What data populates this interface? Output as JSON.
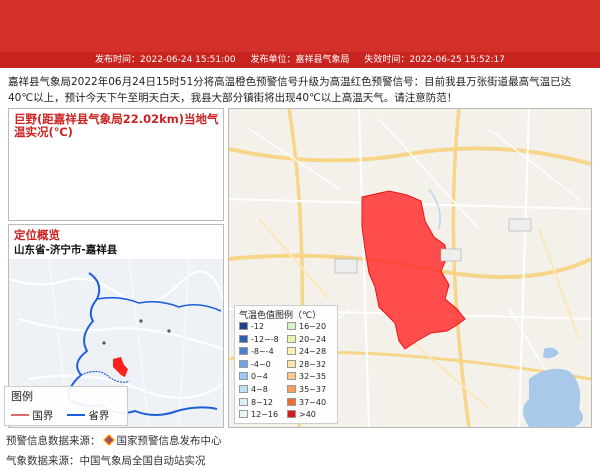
{
  "header": {
    "publish_time": "发布时间：2022-06-24 15:51:00",
    "publisher": "发布单位：嘉祥县气象局",
    "expire_time": "失效时间：2022-06-25 15:52:17"
  },
  "bulletin": "嘉祥县气象局2022年06月24日15时51分将高温橙色预警信号升级为高温红色预警信号：目前我县万张街道最高气温已达40℃以上，预计今天下午至明天白天，我县大部分镇街将出现40℃以上高温天气。请注意防范！",
  "station_panel": {
    "title": "巨野(距嘉祥县气象局22.02km)当地气温实况(℃)"
  },
  "location_panel": {
    "title": "定位概览",
    "subtitle": "山东省-济宁市-嘉祥县"
  },
  "mini_legend": {
    "title": "图例",
    "national_border": "国界",
    "provincial_border": "省界"
  },
  "color_legend": {
    "title": "气温色值图例（℃）",
    "items": [
      {
        "label": "-12",
        "color": "#1f3f8f"
      },
      {
        "label": "-12~-8",
        "color": "#2e5fb0"
      },
      {
        "label": "-8~-4",
        "color": "#4a7fd0"
      },
      {
        "label": "-4~0",
        "color": "#6fa3e8"
      },
      {
        "label": "0~4",
        "color": "#9cc8f2"
      },
      {
        "label": "4~8",
        "color": "#bfe1f7"
      },
      {
        "label": "8~12",
        "color": "#d9f0f7"
      },
      {
        "label": "12~16",
        "color": "#eaf7ee"
      },
      {
        "label": "16~20",
        "color": "#d7f2c7"
      },
      {
        "label": "20~24",
        "color": "#e8f5b0"
      },
      {
        "label": "24~28",
        "color": "#fbf2b4"
      },
      {
        "label": "28~32",
        "color": "#fde6a8"
      },
      {
        "label": "32~35",
        "color": "#fbc98a"
      },
      {
        "label": "35~37",
        "color": "#f5a05a"
      },
      {
        "label": "37~40",
        "color": "#ef6a32"
      },
      {
        "label": ">40",
        "color": "#d7191c"
      }
    ]
  },
  "footer": {
    "warning_source_label": "预警信息数据来源：",
    "warning_source": "国家预警信息发布中心",
    "weather_source": "气象数据来源：中国气象局全国自动站实况"
  },
  "colors": {
    "banner_red": "#d23029",
    "heat_red": "#ff3b3b",
    "title_red": "#cc2222"
  }
}
